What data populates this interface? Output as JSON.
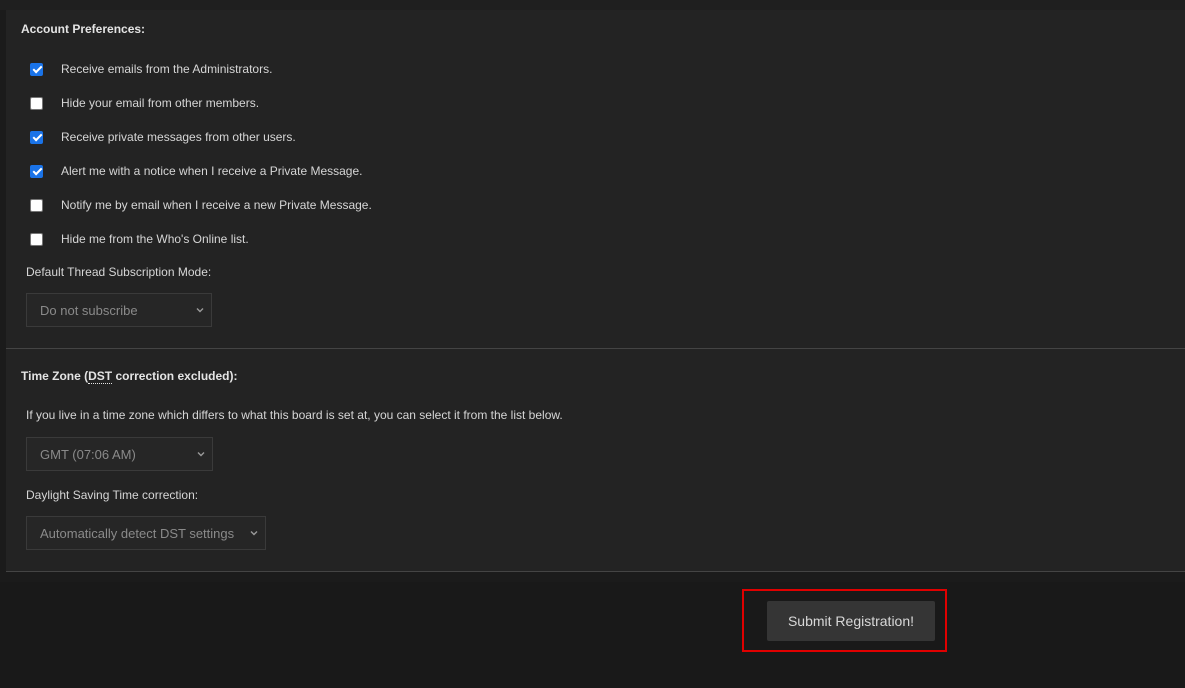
{
  "account_preferences": {
    "heading": "Account Preferences:",
    "options": [
      {
        "label": "Receive emails from the Administrators.",
        "checked": true
      },
      {
        "label": "Hide your email from other members.",
        "checked": false
      },
      {
        "label": "Receive private messages from other users.",
        "checked": true
      },
      {
        "label": "Alert me with a notice when I receive a Private Message.",
        "checked": true
      },
      {
        "label": "Notify me by email when I receive a new Private Message.",
        "checked": false
      },
      {
        "label": "Hide me from the Who's Online list.",
        "checked": false
      }
    ],
    "subscription_label": "Default Thread Subscription Mode:",
    "subscription_value": "Do not subscribe"
  },
  "time_zone": {
    "heading_prefix": "Time Zone (",
    "heading_abbr": "DST",
    "heading_suffix": " correction excluded):",
    "description": "If you live in a time zone which differs to what this board is set at, you can select it from the list below.",
    "tz_value": "GMT (07:06 AM)",
    "dst_label": "Daylight Saving Time correction:",
    "dst_value": "Automatically detect DST settings"
  },
  "footer": {
    "submit_label": "Submit Registration!",
    "highlight_color": "#e00000"
  },
  "colors": {
    "checkbox_checked": "#1a73e8",
    "panel_bg": "#232323",
    "page_bg": "#1b1b1b"
  }
}
